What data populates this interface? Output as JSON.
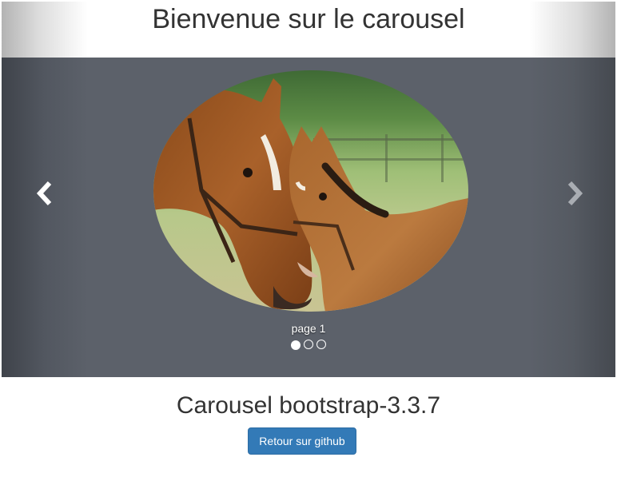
{
  "header": {
    "title": "Bienvenue sur le carousel"
  },
  "carousel": {
    "image_subject": "horses",
    "caption": "page 1",
    "active_index": 0,
    "indicator_count": 3,
    "prev_icon": "chevron-left-icon",
    "next_icon": "chevron-right-icon"
  },
  "main": {
    "subtitle": "Carousel bootstrap-3.3.7",
    "github_button": "Retour sur github"
  },
  "colors": {
    "carousel_bg": "#5c616a",
    "button_primary": "#337ab7",
    "text": "#333333"
  }
}
